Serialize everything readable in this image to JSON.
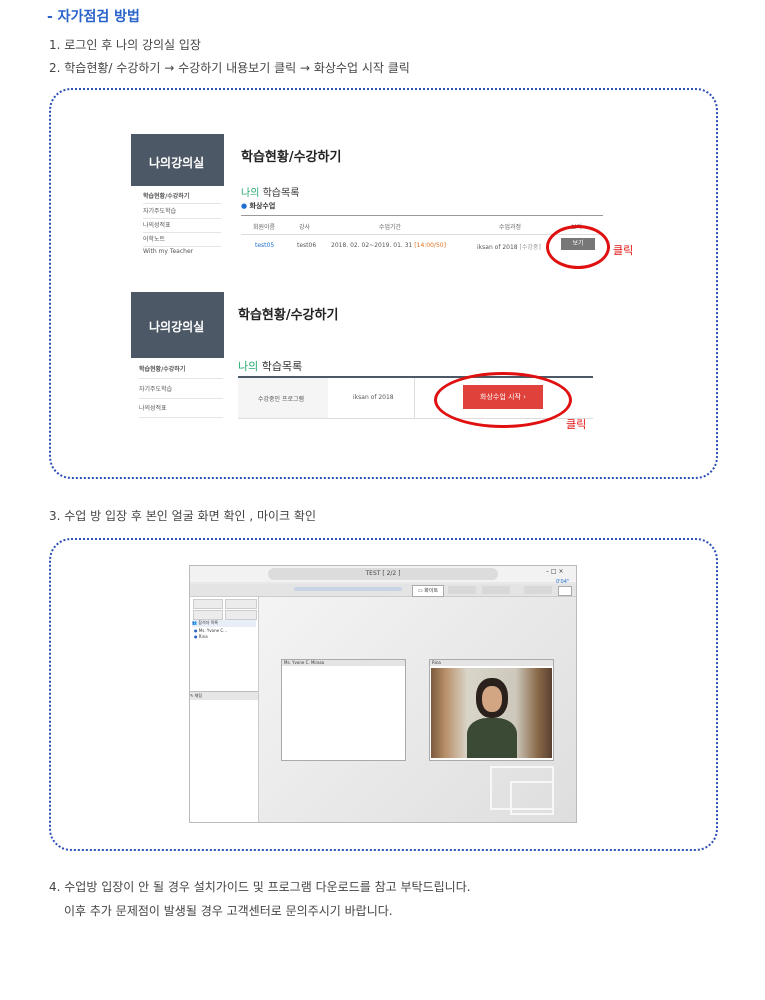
{
  "heading": "- 자가점검 방법",
  "steps": {
    "s1": "1. 로그인 후 나의 강의실 입장",
    "s2": "2. 학습현황/ 수강하기 → 수강하기 내용보기 클릭 → 화상수업 시작 클릭",
    "s3": "3. 수업 방 입장 후 본인 얼굴 화면 확인 , 마이크 확인",
    "s4a": "4. 수업방 입장이 안 될 경우 설치가이드 및 프로그램 다운로드를 참고 부탁드립니다.",
    "s4b": "이후 추가 문제점이 발생될 경우 고객센터로 문의주시기 바랍니다."
  },
  "shot1": {
    "sidebar_title": "나의강의실",
    "sidebar_items": [
      "학습현황/수강하기",
      "자기주도학습",
      "나의성적표",
      "어학노트",
      "With my Teacher"
    ],
    "page_title": "학습현황/수강하기",
    "section_prefix": "나의",
    "section_title": "학습목록",
    "subsection": "화상수업",
    "table_headers": [
      "회원이름",
      "강사",
      "수업기간",
      "수업과정",
      "보기"
    ],
    "row": {
      "member": "test05",
      "teacher": "test06",
      "period": "2018. 02. 02~2019. 01. 31",
      "period_extra": "[14:00/50]",
      "course": "iksan of 2018",
      "course_extra": "[수강중]",
      "view_btn": "보기"
    },
    "click_label": "클릭"
  },
  "shot2": {
    "sidebar_title": "나의강의실",
    "sidebar_items": [
      "학습현황/수강하기",
      "자기주도학습",
      "나의성적표"
    ],
    "page_title": "학습현황/수강하기",
    "section_prefix": "나의",
    "section_title": "학습목록",
    "row_label": "수강중인 프로그램",
    "row_value": "iksan of 2018",
    "start_btn": "화상수업 시작",
    "click_label": "클릭"
  },
  "shot3": {
    "window_title": "TEST [ 2/2 ]",
    "timer": "0'04\"",
    "tab_active": "화이트",
    "participants_header": "참석자 목록",
    "participants": [
      "Ms. Yvone C...",
      "Rina"
    ],
    "chat_label": "채팅",
    "video1_label": "Ms. Yvone C. Mirasa",
    "video2_label": "Rina"
  },
  "colors": {
    "heading": "#2a63c9",
    "dotted_border": "#2d4fb6",
    "highlight_red": "#e01010",
    "start_button": "#e0413a",
    "accent_green": "#25a86f"
  }
}
